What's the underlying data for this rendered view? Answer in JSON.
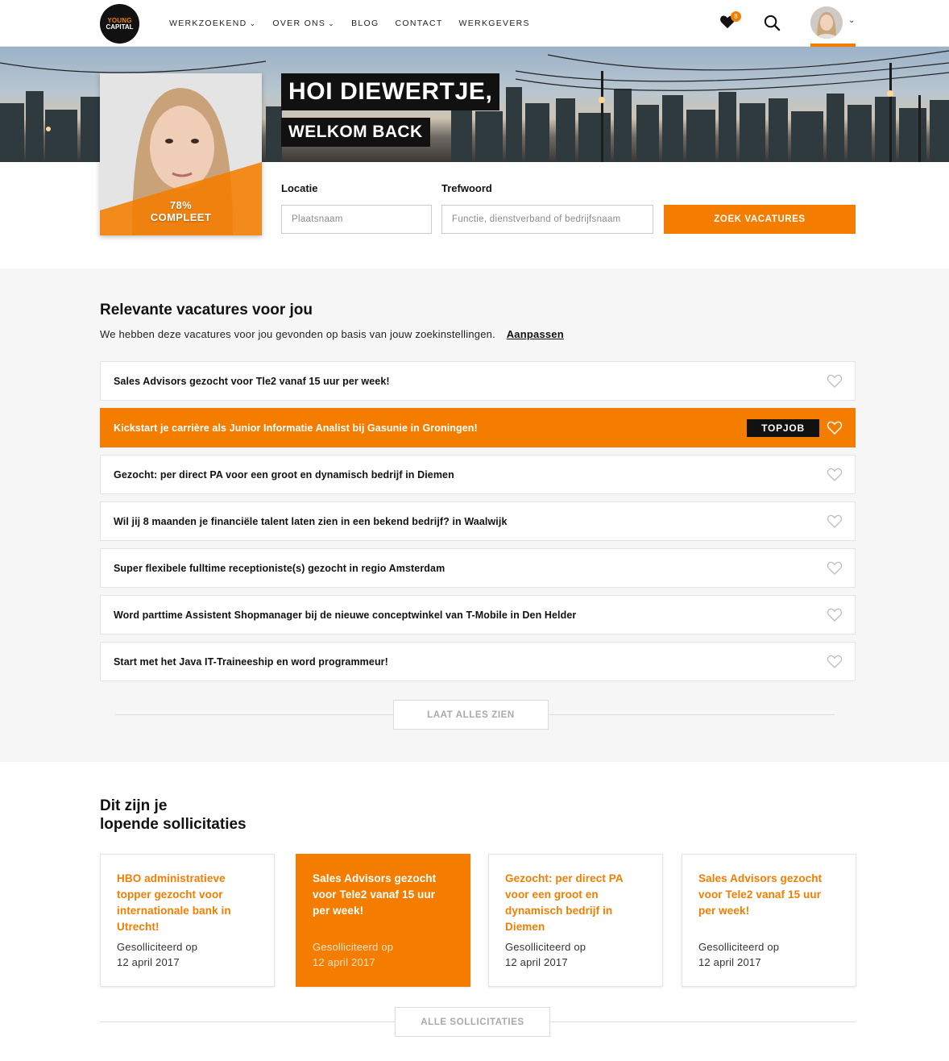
{
  "header": {
    "logo": {
      "line1": "YOUNG",
      "line2": "CAPITAL"
    },
    "nav": [
      {
        "label": "WERKZOEKEND",
        "has_dropdown": true
      },
      {
        "label": "OVER ONS",
        "has_dropdown": true
      },
      {
        "label": "BLOG",
        "has_dropdown": false
      },
      {
        "label": "CONTACT",
        "has_dropdown": false
      },
      {
        "label": "WERKGEVERS",
        "has_dropdown": false
      }
    ],
    "favorites_count": "8",
    "icons": [
      "heart-icon",
      "search-icon",
      "chevron-down-icon"
    ]
  },
  "hero": {
    "greeting": "HOI DIEWERTJE,",
    "subgreeting": "WELKOM BACK",
    "profile_pct": "78%",
    "profile_label": "COMPLEET"
  },
  "search": {
    "location_label": "Locatie",
    "location_placeholder": "Plaatsnaam",
    "keyword_label": "Trefwoord",
    "keyword_placeholder": "Functie, dienstverband of bedrijfsnaam",
    "button": "ZOEK VACATURES"
  },
  "relevant": {
    "title": "Relevante vacatures voor jou",
    "subtitle": "We hebben deze vacatures voor jou gevonden op basis van jouw zoekinstellingen.",
    "adjust_link": "Aanpassen",
    "jobs": [
      {
        "title": "Sales Advisors gezocht voor Tle2 vanaf 15 uur per week!"
      },
      {
        "title": "Kickstart je carrière als Junior Informatie Analist bij Gasunie in Groningen!",
        "badge": "TOPJOB"
      },
      {
        "title": "Gezocht: per direct PA voor een groot en dynamisch bedrijf in Diemen"
      },
      {
        "title": "Wil jij 8 maanden je financiële talent laten zien in een bekend bedrijf? in Waalwijk"
      },
      {
        "title": "Super flexibele fulltime receptioniste(s) gezocht in regio Amsterdam"
      },
      {
        "title": "Word parttime Assistent Shopmanager bij de nieuwe conceptwinkel van T-Mobile in Den Helder"
      },
      {
        "title": "Start met het Java IT-Traineeship en word programmeur!"
      }
    ],
    "show_all": "LAAT ALLES ZIEN"
  },
  "applications": {
    "title_line1": "Dit zijn je",
    "title_line2": "lopende sollicitaties",
    "cards": [
      {
        "title": "HBO administratieve topper gezocht voor internationale bank in Utrecht!",
        "applied_label": "Gesolliciteerd op",
        "date": "12 april 2017"
      },
      {
        "title": "Sales Advisors gezocht voor Tele2 vanaf 15 uur per week!",
        "applied_label": "Gesolliciteerd op",
        "date": "12 april 2017"
      },
      {
        "title": "Gezocht: per direct PA voor een groot en dynamisch bedrijf in Diemen",
        "applied_label": "Gesolliciteerd op",
        "date": "12 april 2017"
      },
      {
        "title": "Sales Advisors gezocht voor Tele2 vanaf 15 uur per week!",
        "applied_label": "Gesolliciteerd op",
        "date": "12 april 2017"
      }
    ],
    "all_button": "ALLE SOLLICITATIES"
  },
  "colors": {
    "accent": "#f47d00",
    "dark": "#111111",
    "section_bg": "#f6f6f6"
  }
}
